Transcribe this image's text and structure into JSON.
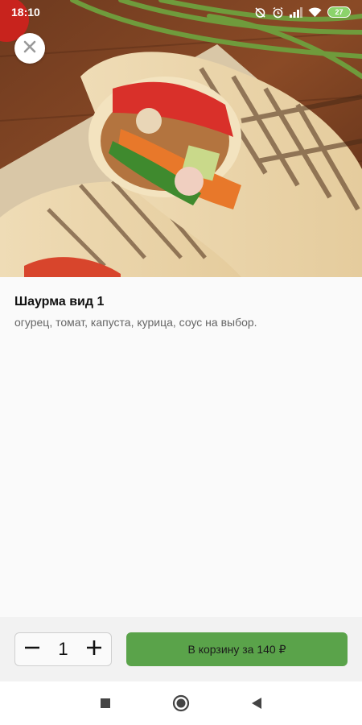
{
  "status_bar": {
    "time": "18:10",
    "battery_level": "27",
    "icons": [
      "alarm-off-icon",
      "alarm-icon",
      "signal-icon",
      "wifi-icon",
      "battery-icon"
    ]
  },
  "hero": {
    "image": "shawarma-wrap-photo",
    "close_icon": "close-icon"
  },
  "product": {
    "name": "Шаурма вид 1",
    "description": "огурец, томат, капуста, курица, соус на выбор."
  },
  "order": {
    "quantity": "1",
    "minus_icon": "minus-icon",
    "plus_icon": "plus-icon",
    "add_to_cart_label": "В корзину за 140 ₽"
  },
  "nav_bar": {
    "icons": [
      "recents-square-icon",
      "home-circle-icon",
      "back-triangle-icon"
    ]
  },
  "colors": {
    "accent_green": "#5aa34a",
    "content_bg": "#fafafa",
    "bottom_bar_bg": "#f2f2f2"
  }
}
